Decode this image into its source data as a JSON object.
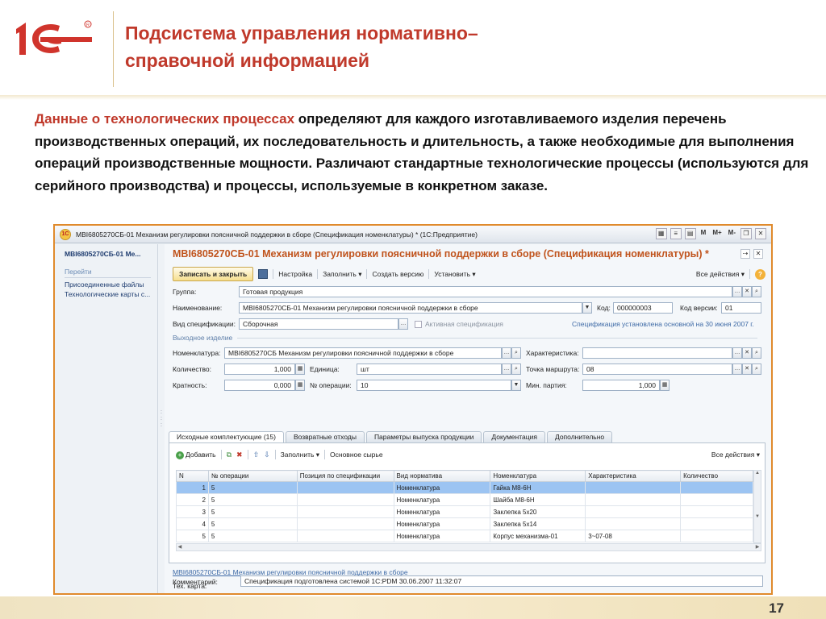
{
  "slide": {
    "title_line1": "Подсистема управления нормативно–",
    "title_line2": "справочной информацией",
    "body_hl": "Данные о технологических процессах",
    "body_rest": " определяют для каждого изготавливаемого изделия перечень производственных операций, их последовательность и длительность, а также необходимые для выполнения операций производственные мощности. Различают стандартные технологические процессы (используются для серийного производства) и процессы, используемые в конкретном заказе.",
    "page_number": "17",
    "accent_color": "#c0392b",
    "frame_color": "#e08a2c"
  },
  "window": {
    "title": "MBI6805270СБ-01 Механизм регулировки поясничной поддержки в сборе (Спецификация номенклатуры) * (1С:Предприятие)",
    "app_icon": "1C",
    "btn_m": "M",
    "btn_mplus": "M+",
    "btn_mminus": "M-"
  },
  "left": {
    "title": "MBI6805270СБ-01 Ме...",
    "goto": "Перейти",
    "links": [
      "Присоединенные файлы",
      "Технологические карты с..."
    ]
  },
  "form": {
    "title": "MBI6805270СБ-01 Механизм регулировки поясничной поддержки в сборе (Спецификация номенклатуры) *",
    "save_close": "Записать и закрыть",
    "settings": "Настройка",
    "fill": "Заполнить ▾",
    "create_version": "Создать версию",
    "install": "Установить ▾",
    "all_actions": "Все действия ▾",
    "help": "?",
    "group_label": "Группа:",
    "group_value": "Готовая продукция",
    "name_label": "Наименование:",
    "name_value": "MBI6805270СБ-01 Механизм регулировки поясничной поддержки в сборе",
    "code_label": "Код:",
    "code_value": "000000003",
    "version_code_label": "Код версии:",
    "version_code_value": "01",
    "spec_type_label": "Вид спецификации:",
    "spec_type_value": "Сборочная",
    "active_spec_label": "Активная спецификация",
    "spec_installed_note": "Спецификация установлена основной на 30 июня 2007 г.",
    "output_section": "Выходное изделие",
    "nomen_label": "Номенклатура:",
    "nomen_value": "MBI6805270СБ Механизм регулировки поясничной поддержки в сборе",
    "char_label": "Характеристика:",
    "char_value": "",
    "qty_label": "Количество:",
    "qty_value": "1,000",
    "unit_label": "Единица:",
    "unit_value": "шт",
    "route_label": "Точка маршрута:",
    "route_value": "08",
    "mult_label": "Кратность:",
    "mult_value": "0,000",
    "op_no_label": "№ операции:",
    "op_no_value": "10",
    "min_batch_label": "Мин. партия:",
    "min_batch_value": "1,000",
    "link_text": "MBI6805270СБ-01 Механизм регулировки поясничной поддержки в сборе",
    "tech_card_label": "Тех. карта:",
    "comment_label": "Комментарий:",
    "comment_value": "Спецификация подготовлена системой 1С:PDM 30.06.2007 11:32:07"
  },
  "tabs": [
    {
      "label": "Исходные комплектующие (15)"
    },
    {
      "label": "Возвратные отходы"
    },
    {
      "label": "Параметры выпуска продукции"
    },
    {
      "label": "Документация"
    },
    {
      "label": "Дополнительно"
    }
  ],
  "table_toolbar": {
    "add": "Добавить",
    "fill": "Заполнить ▾",
    "main_raw": "Основное сырье",
    "all_actions": "Все действия ▾"
  },
  "table": {
    "columns": [
      "N",
      "№ операции",
      "Позиция по спецификации",
      "Вид норматива",
      "Номенклатура",
      "Характеристика",
      "Количество"
    ],
    "rows": [
      [
        "1",
        "5",
        "",
        "Номенклатура",
        "Гайка М8-6Н",
        "",
        ""
      ],
      [
        "2",
        "5",
        "",
        "Номенклатура",
        "Шайба М8-6Н",
        "",
        ""
      ],
      [
        "3",
        "5",
        "",
        "Номенклатура",
        "Заклепка 5х20",
        "",
        ""
      ],
      [
        "4",
        "5",
        "",
        "Номенклатура",
        "Заклепка 5х14",
        "",
        ""
      ],
      [
        "5",
        "5",
        "",
        "Номенклатура",
        "Корпус механизма-01",
        "3~07-08",
        ""
      ]
    ]
  }
}
